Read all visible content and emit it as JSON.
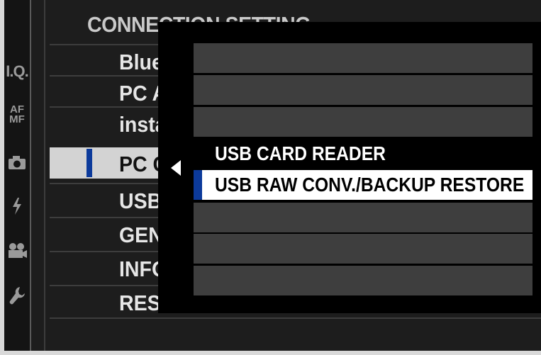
{
  "menu": {
    "title": "CONNECTION SETTING",
    "items": [
      {
        "label": "Blue"
      },
      {
        "label": "PC A"
      },
      {
        "label": "insta"
      },
      {
        "label": "PC C"
      },
      {
        "label": "USB"
      },
      {
        "label": "GEN"
      },
      {
        "label": "INFO"
      },
      {
        "label": "RES"
      }
    ],
    "selected_index": 3
  },
  "sidebar": {
    "icons": [
      "iq-icon",
      "af-mf-icon",
      "camera-icon",
      "flash-icon",
      "movie-icon",
      "wrench-icon"
    ],
    "iq_label": "I.Q.",
    "af_label": "AF",
    "mf_label": "MF"
  },
  "popup": {
    "options": [
      {
        "label": ""
      },
      {
        "label": ""
      },
      {
        "label": ""
      },
      {
        "label": "USB CARD READER"
      },
      {
        "label": "USB RAW CONV./BACKUP RESTORE"
      },
      {
        "label": ""
      },
      {
        "label": ""
      },
      {
        "label": ""
      }
    ],
    "selected_index": 4
  },
  "colors": {
    "background": "#1d1d1d",
    "selection_marker": "#0c3a9b",
    "highlight": "#ffffff"
  }
}
